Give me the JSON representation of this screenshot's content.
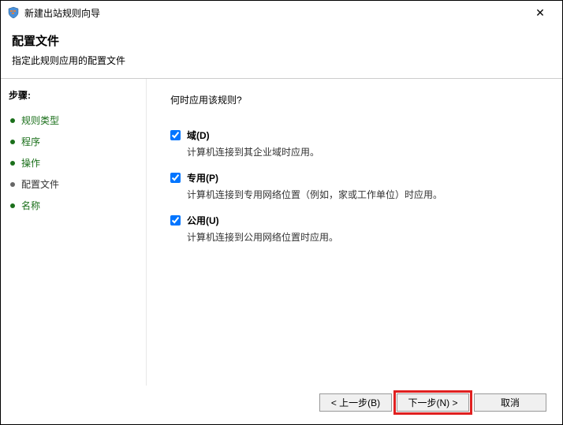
{
  "window": {
    "title": "新建出站规则向导",
    "close": "✕"
  },
  "header": {
    "title": "配置文件",
    "desc": "指定此规则应用的配置文件"
  },
  "sidebar": {
    "heading": "步骤:",
    "steps": [
      {
        "label": "规则类型",
        "current": false
      },
      {
        "label": "程序",
        "current": false
      },
      {
        "label": "操作",
        "current": false
      },
      {
        "label": "配置文件",
        "current": true
      },
      {
        "label": "名称",
        "current": false
      }
    ]
  },
  "content": {
    "prompt": "何时应用该规则?",
    "options": [
      {
        "label": "域(D)",
        "desc": "计算机连接到其企业域时应用。",
        "checked": true
      },
      {
        "label": "专用(P)",
        "desc": "计算机连接到专用网络位置（例如，家或工作单位）时应用。",
        "checked": true
      },
      {
        "label": "公用(U)",
        "desc": "计算机连接到公用网络位置时应用。",
        "checked": true
      }
    ]
  },
  "footer": {
    "back": "< 上一步(B)",
    "next": "下一步(N) >",
    "cancel": "取消"
  }
}
